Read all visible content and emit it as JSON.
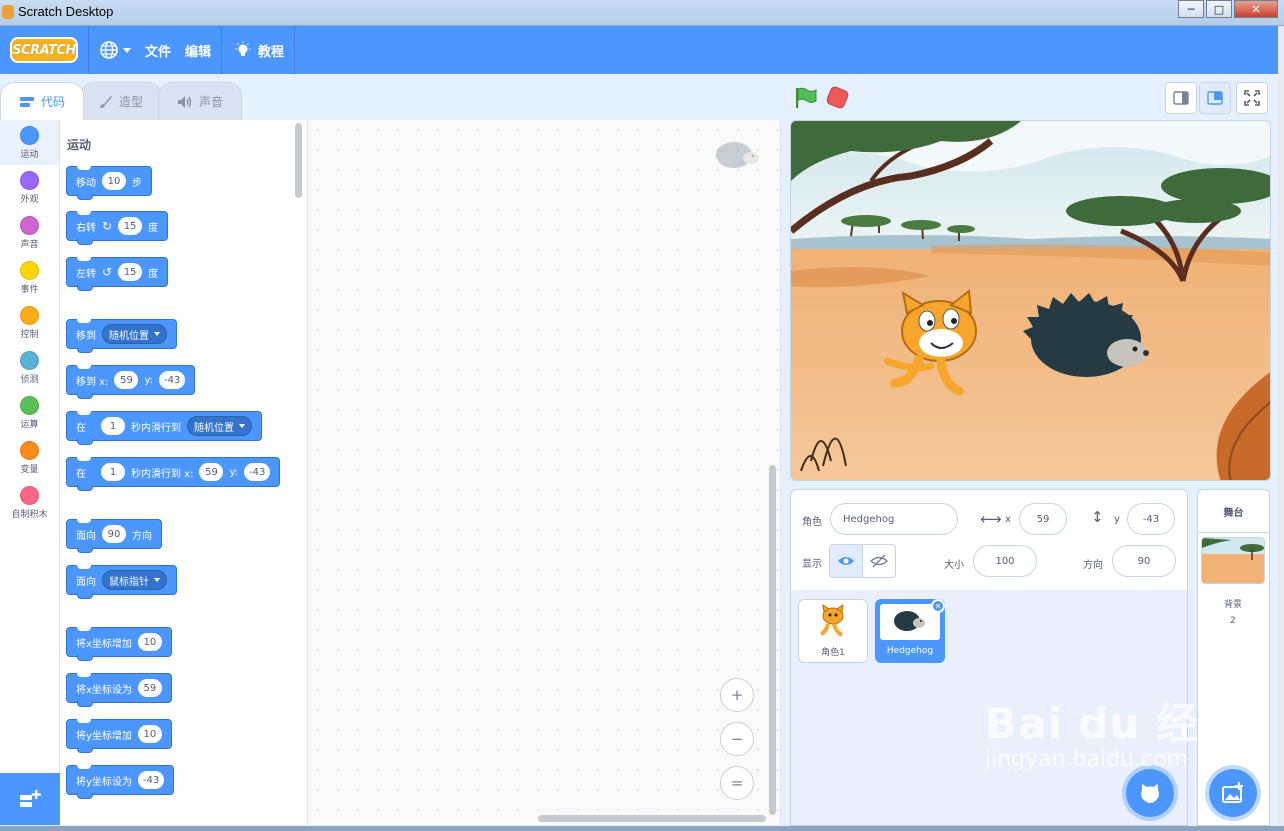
{
  "window": {
    "title": "Scratch Desktop",
    "min": "─",
    "max": "□",
    "close": "✕"
  },
  "menubar": {
    "logo": "SCRATCH",
    "file": "文件",
    "edit": "编辑",
    "tutorials": "教程"
  },
  "tabs": [
    {
      "label": "代码"
    },
    {
      "label": "造型"
    },
    {
      "label": "声音"
    }
  ],
  "categories": [
    {
      "label": "运动",
      "color": "#4c97ff"
    },
    {
      "label": "外观",
      "color": "#9966ff"
    },
    {
      "label": "声音",
      "color": "#cf63cf"
    },
    {
      "label": "事件",
      "color": "#ffd500"
    },
    {
      "label": "控制",
      "color": "#ffab19"
    },
    {
      "label": "侦测",
      "color": "#5cb1d6"
    },
    {
      "label": "运算",
      "color": "#59c059"
    },
    {
      "label": "变量",
      "color": "#ff8c1a"
    },
    {
      "label": "自制积木",
      "color": "#ff6680"
    }
  ],
  "palette": {
    "heading": "运动",
    "move": {
      "a": "移动",
      "v": "10",
      "b": "步"
    },
    "turn_right": {
      "a": "右转",
      "v": "15",
      "b": "度"
    },
    "turn_left": {
      "a": "左转",
      "v": "15",
      "b": "度"
    },
    "goto": {
      "a": "移到",
      "dd": "随机位置"
    },
    "goto_xy": {
      "a": "移到 x:",
      "x": "59",
      "y_label": "y:",
      "y": "-43"
    },
    "glide": {
      "a": "在",
      "v": "1",
      "b": "秒内滑行到",
      "dd": "随机位置"
    },
    "glide_xy": {
      "a": "在",
      "v": "1",
      "b": "秒内滑行到 x:",
      "x": "59",
      "y_label": "y:",
      "y": "-43"
    },
    "point_dir": {
      "a": "面向",
      "v": "90",
      "b": "方向"
    },
    "point_towards": {
      "a": "面向",
      "dd": "鼠标指针"
    },
    "change_x": {
      "a": "将x坐标增加",
      "v": "10"
    },
    "set_x": {
      "a": "将x坐标设为",
      "v": "59"
    },
    "change_y": {
      "a": "将y坐标增加",
      "v": "10"
    },
    "set_y": {
      "a": "将y坐标设为",
      "v": "-43"
    }
  },
  "zoom": {
    "in": "+",
    "out": "−",
    "reset": "="
  },
  "sprite_info": {
    "sprite_label": "角色",
    "sprite_name": "Hedgehog",
    "x_label": "x",
    "x": "59",
    "y_label": "y",
    "y": "-43",
    "show_label": "显示",
    "size_label": "大小",
    "size": "100",
    "direction_label": "方向",
    "direction": "90"
  },
  "sprites": [
    {
      "name": "角色1"
    },
    {
      "name": "Hedgehog"
    }
  ],
  "stage_pane": {
    "title": "舞台",
    "backdrops_label": "背景",
    "backdrops_count": "2"
  },
  "watermark": {
    "brand": "Bai du 经验",
    "url": "jingyan.baidu.com"
  }
}
